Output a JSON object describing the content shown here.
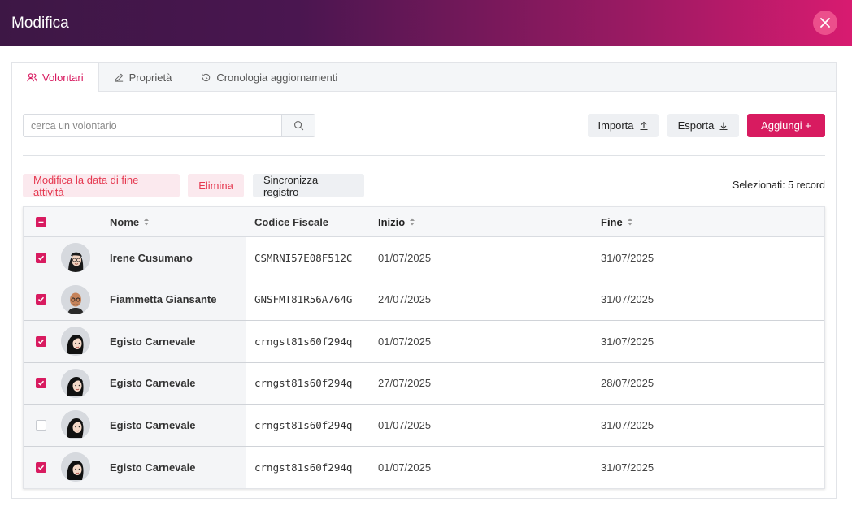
{
  "modal": {
    "title": "Modifica"
  },
  "tabs": [
    {
      "label": "Volontari",
      "icon": "users-icon",
      "active": true
    },
    {
      "label": "Proprietà",
      "icon": "pencil-icon",
      "active": false
    },
    {
      "label": "Cronologia aggiornamenti",
      "icon": "history-icon",
      "active": false
    }
  ],
  "search": {
    "placeholder": "cerca un volontario",
    "value": ""
  },
  "toolbar": {
    "import_label": "Importa",
    "export_label": "Esporta",
    "add_label": "Aggiungi +"
  },
  "actions": {
    "edit_end_date": "Modifica la data di fine attività",
    "delete": "Elimina",
    "sync": "Sincronizza registro"
  },
  "selection": {
    "text": "Selezionati: 5 record"
  },
  "table": {
    "headers": {
      "nome": "Nome",
      "codice_fiscale": "Codice Fiscale",
      "inizio": "Inizio",
      "fine": "Fine"
    },
    "rows": [
      {
        "checked": true,
        "avatar": "avatar-woman-glasses",
        "nome": "Irene Cusumano",
        "cf": "CSMRNI57E08F512C",
        "inizio": "01/07/2025",
        "fine": "31/07/2025"
      },
      {
        "checked": true,
        "avatar": "avatar-man-bald",
        "nome": "Fiammetta Giansante",
        "cf": "GNSFMT81R56A764G",
        "inizio": "24/07/2025",
        "fine": "31/07/2025"
      },
      {
        "checked": true,
        "avatar": "avatar-woman-dark-hair",
        "nome": "Egisto Carnevale",
        "cf": "crngst81s60f294q",
        "inizio": "01/07/2025",
        "fine": "31/07/2025"
      },
      {
        "checked": true,
        "avatar": "avatar-woman-dark-hair",
        "nome": "Egisto Carnevale",
        "cf": "crngst81s60f294q",
        "inizio": "27/07/2025",
        "fine": "28/07/2025"
      },
      {
        "checked": false,
        "avatar": "avatar-woman-dark-hair",
        "nome": "Egisto Carnevale",
        "cf": "crngst81s60f294q",
        "inizio": "01/07/2025",
        "fine": "31/07/2025"
      },
      {
        "checked": true,
        "avatar": "avatar-woman-dark-hair",
        "nome": "Egisto Carnevale",
        "cf": "crngst81s60f294q",
        "inizio": "01/07/2025",
        "fine": "31/07/2025"
      }
    ]
  },
  "colors": {
    "accent": "#d81b60",
    "header_start": "#3d1745",
    "header_end": "#d81b70",
    "danger_text": "#e53950"
  }
}
